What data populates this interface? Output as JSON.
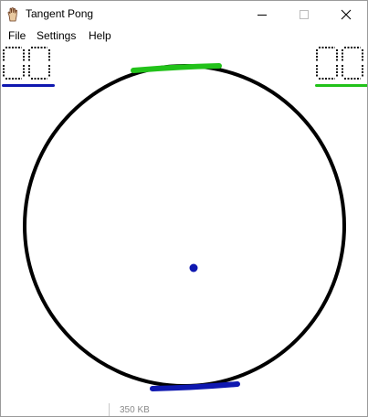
{
  "window": {
    "title": "Tangent Pong",
    "app_icon": "hand-icon",
    "controls": [
      "minimize-icon",
      "maximize-icon",
      "close-icon"
    ]
  },
  "menu": {
    "items": [
      "File",
      "Settings",
      "Help"
    ]
  },
  "game": {
    "left_score": "00",
    "right_score": "00",
    "colors": {
      "left_player": "#0f18b0",
      "right_player": "#22c21a",
      "ring": "#000000",
      "ball": "#0f18b0"
    }
  },
  "status": {
    "text": "350 KB"
  }
}
